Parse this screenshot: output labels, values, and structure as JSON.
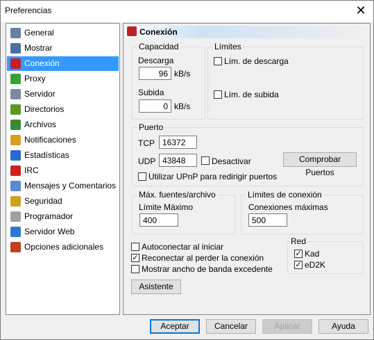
{
  "window": {
    "title": "Preferencias"
  },
  "sidebar": {
    "items": [
      {
        "label": "General",
        "icon": "gear-icon",
        "color": "#6b7fa3"
      },
      {
        "label": "Mostrar",
        "icon": "monitor-icon",
        "color": "#4a6ea8"
      },
      {
        "label": "Conexión",
        "icon": "plug-icon",
        "color": "#c0202a"
      },
      {
        "label": "Proxy",
        "icon": "proxy-icon",
        "color": "#3aa03a"
      },
      {
        "label": "Servidor",
        "icon": "server-icon",
        "color": "#7a8aa0"
      },
      {
        "label": "Directorios",
        "icon": "folder-icon",
        "color": "#5a9a20"
      },
      {
        "label": "Archivos",
        "icon": "files-icon",
        "color": "#3a8a3a"
      },
      {
        "label": "Notificaciones",
        "icon": "notifications-icon",
        "color": "#d8a020"
      },
      {
        "label": "Estadísticas",
        "icon": "statistics-icon",
        "color": "#2a6ad0"
      },
      {
        "label": "IRC",
        "icon": "irc-icon",
        "color": "#d02020"
      },
      {
        "label": "Mensajes y Comentarios",
        "icon": "messages-icon",
        "color": "#5a8ad0"
      },
      {
        "label": "Seguridad",
        "icon": "lock-icon",
        "color": "#d0a020"
      },
      {
        "label": "Programador",
        "icon": "scheduler-icon",
        "color": "#a0a0a0"
      },
      {
        "label": "Servidor Web",
        "icon": "globe-icon",
        "color": "#2a7ad0"
      },
      {
        "label": "Opciones adicionales",
        "icon": "tools-icon",
        "color": "#c04020"
      }
    ]
  },
  "panel": {
    "title": "Conexión",
    "capacity": {
      "title": "Capacidad",
      "download_label": "Descarga",
      "download_value": "96",
      "download_unit": "kB/s",
      "upload_label": "Subida",
      "upload_value": "0",
      "upload_unit": "kB/s"
    },
    "limits": {
      "title": "Límites",
      "download_limit": "Lím. de descarga",
      "upload_limit": "Lím. de subida"
    },
    "port": {
      "title": "Puerto",
      "tcp_label": "TCP",
      "tcp_value": "16372",
      "udp_label": "UDP",
      "udp_value": "43848",
      "disable_label": "Desactivar",
      "check_ports": "Comprobar Puertos",
      "upnp_label": "Utilizar UPnP para redirigir puertos"
    },
    "sources": {
      "title": "Máx. fuentes/archivo",
      "max_label": "Límite Máximo",
      "max_value": "400"
    },
    "conn_limits": {
      "title": "Límites de conexión",
      "max_label": "Conexiones máximas",
      "max_value": "500"
    },
    "options": {
      "autoconnect": "Autoconectar al iniciar",
      "reconnect": "Reconectar al perder la conexión",
      "overhead": "Mostrar ancho de banda excedente",
      "reconnect_checked": "✓"
    },
    "network": {
      "title": "Red",
      "kad": "Kad",
      "ed2k": "eD2K",
      "kad_checked": "✓",
      "ed2k_checked": "✓"
    },
    "wizard": "Asistente"
  },
  "buttons": {
    "accept": "Aceptar",
    "cancel": "Cancelar",
    "apply": "Aplicar",
    "help": "Ayuda"
  },
  "close_glyph": "✕"
}
